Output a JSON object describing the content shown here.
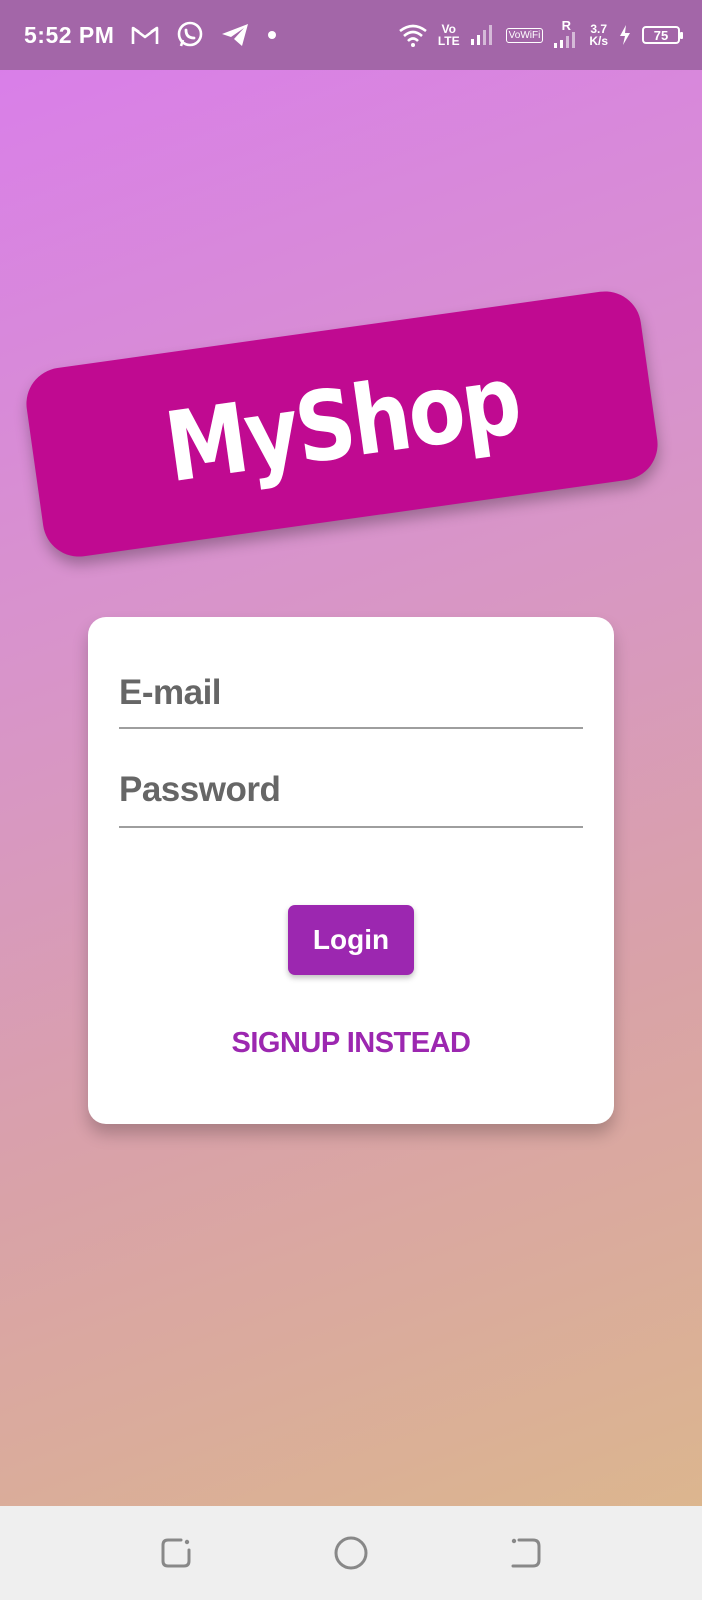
{
  "status_bar": {
    "time": "5:52 PM",
    "network_top": "Vo",
    "network_bottom": "LTE",
    "vowifi": "VoWiFi",
    "roaming": "R",
    "speed_top": "3.7",
    "speed_bottom": "K/s",
    "battery": "75",
    "icons": [
      "gmail-icon",
      "whatsapp-icon",
      "telegram-icon",
      "notification-dot-icon",
      "wifi-icon",
      "signal-icon",
      "charging-icon",
      "battery-icon"
    ]
  },
  "logo": {
    "text": "MyShop",
    "color": "#c00a91"
  },
  "auth": {
    "email_placeholder": "E-mail",
    "email_value": "",
    "password_placeholder": "Password",
    "password_value": "",
    "login_label": "Login",
    "signup_label": "SIGNUP INSTEAD",
    "accent_color": "#9c27b0"
  },
  "nav": {
    "icons": [
      "recent-apps-icon",
      "home-icon",
      "back-icon"
    ]
  }
}
